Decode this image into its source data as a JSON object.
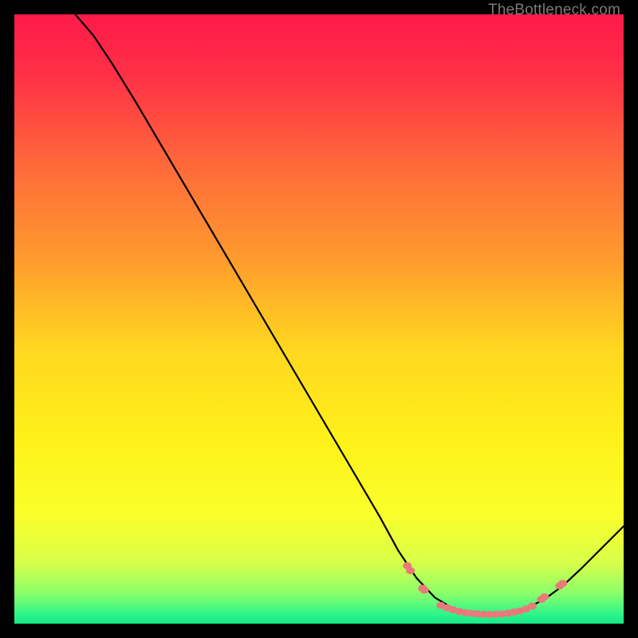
{
  "watermark": "TheBottleneck.com",
  "chart_data": {
    "type": "line",
    "title": "",
    "xlabel": "",
    "ylabel": "",
    "xlim": [
      0,
      100
    ],
    "ylim": [
      0,
      100
    ],
    "grid": false,
    "legend": false,
    "background_gradient_stops": [
      {
        "offset": 0.0,
        "color": "#ff1a4a"
      },
      {
        "offset": 0.1,
        "color": "#ff3046"
      },
      {
        "offset": 0.25,
        "color": "#ff6a3a"
      },
      {
        "offset": 0.4,
        "color": "#ff9a2e"
      },
      {
        "offset": 0.55,
        "color": "#ffd71f"
      },
      {
        "offset": 0.7,
        "color": "#fff11a"
      },
      {
        "offset": 0.82,
        "color": "#faff2a"
      },
      {
        "offset": 0.9,
        "color": "#d8ff4a"
      },
      {
        "offset": 0.95,
        "color": "#8bff6a"
      },
      {
        "offset": 0.985,
        "color": "#2cf58a"
      },
      {
        "offset": 1.0,
        "color": "#18e88a"
      }
    ],
    "series": [
      {
        "name": "bottleneck-curve",
        "stroke": "#000000",
        "points": [
          {
            "x": 10.0,
            "y": 100.0
          },
          {
            "x": 13.0,
            "y": 96.5
          },
          {
            "x": 16.0,
            "y": 92.0
          },
          {
            "x": 20.0,
            "y": 85.5
          },
          {
            "x": 25.0,
            "y": 77.0
          },
          {
            "x": 30.0,
            "y": 68.5
          },
          {
            "x": 35.0,
            "y": 60.0
          },
          {
            "x": 40.0,
            "y": 51.5
          },
          {
            "x": 45.0,
            "y": 43.0
          },
          {
            "x": 50.0,
            "y": 34.5
          },
          {
            "x": 55.0,
            "y": 26.0
          },
          {
            "x": 60.0,
            "y": 17.5
          },
          {
            "x": 63.0,
            "y": 12.0
          },
          {
            "x": 66.0,
            "y": 7.5
          },
          {
            "x": 69.0,
            "y": 4.3
          },
          {
            "x": 72.0,
            "y": 2.5
          },
          {
            "x": 75.0,
            "y": 1.7
          },
          {
            "x": 78.0,
            "y": 1.5
          },
          {
            "x": 81.0,
            "y": 1.7
          },
          {
            "x": 84.0,
            "y": 2.5
          },
          {
            "x": 87.0,
            "y": 4.0
          },
          {
            "x": 90.0,
            "y": 6.2
          },
          {
            "x": 93.0,
            "y": 9.0
          },
          {
            "x": 96.0,
            "y": 12.0
          },
          {
            "x": 100.0,
            "y": 16.0
          }
        ]
      }
    ],
    "markers": {
      "name": "dotted-region",
      "color": "#e97a7a",
      "points": [
        {
          "x": 64.5,
          "y": 9.5
        },
        {
          "x": 65.0,
          "y": 8.7
        },
        {
          "x": 67.0,
          "y": 5.8
        },
        {
          "x": 67.3,
          "y": 5.5
        },
        {
          "x": 70.0,
          "y": 3.0
        },
        {
          "x": 71.0,
          "y": 2.6
        },
        {
          "x": 72.0,
          "y": 2.3
        },
        {
          "x": 73.0,
          "y": 2.0
        },
        {
          "x": 74.0,
          "y": 1.8
        },
        {
          "x": 75.0,
          "y": 1.7
        },
        {
          "x": 76.0,
          "y": 1.6
        },
        {
          "x": 77.0,
          "y": 1.55
        },
        {
          "x": 78.0,
          "y": 1.5
        },
        {
          "x": 79.0,
          "y": 1.55
        },
        {
          "x": 80.0,
          "y": 1.6
        },
        {
          "x": 81.0,
          "y": 1.7
        },
        {
          "x": 82.0,
          "y": 1.9
        },
        {
          "x": 83.0,
          "y": 2.1
        },
        {
          "x": 84.0,
          "y": 2.4
        },
        {
          "x": 85.0,
          "y": 2.9
        },
        {
          "x": 86.5,
          "y": 4.0
        },
        {
          "x": 87.0,
          "y": 4.4
        },
        {
          "x": 89.5,
          "y": 6.2
        },
        {
          "x": 90.0,
          "y": 6.6
        }
      ]
    }
  }
}
